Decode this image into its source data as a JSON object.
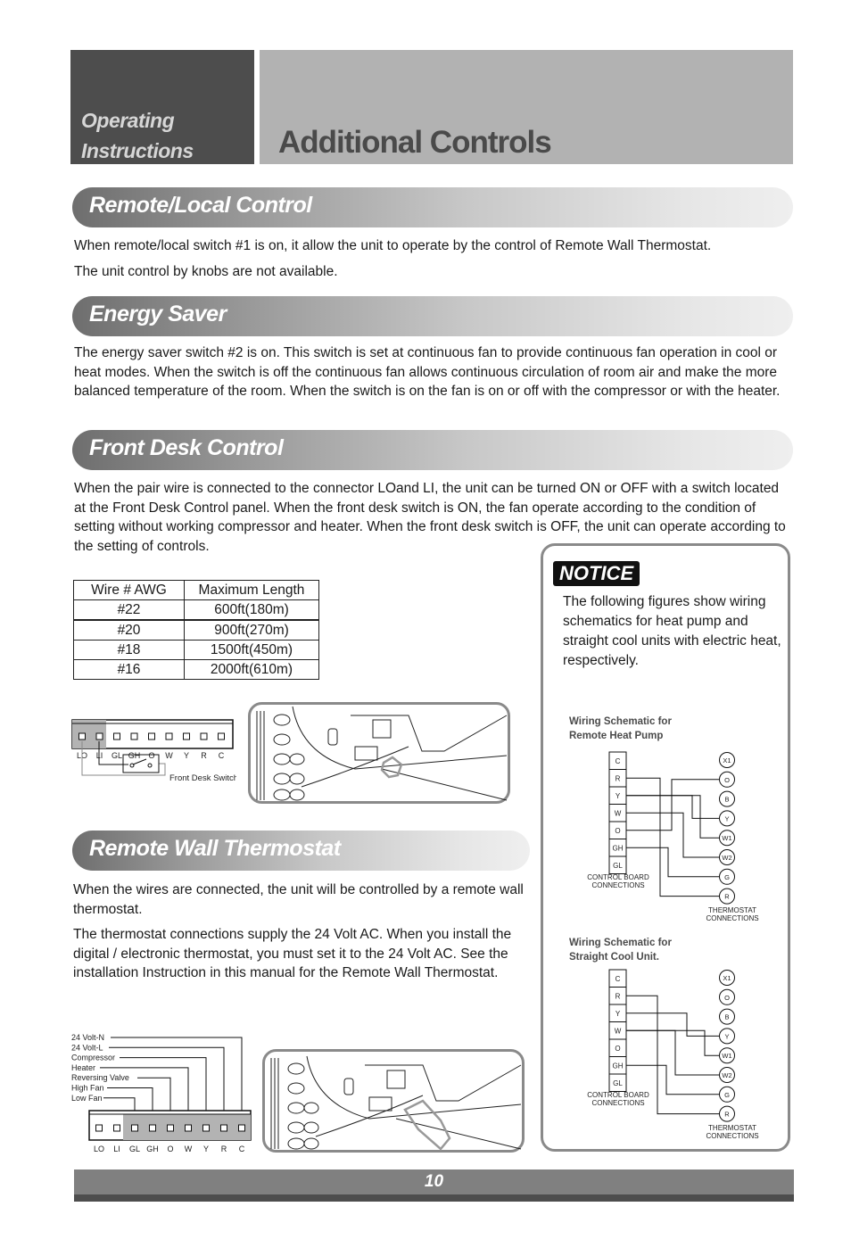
{
  "header": {
    "section_line1": "Operating",
    "section_line2": "Instructions",
    "title": "Additional Controls"
  },
  "sections": {
    "remote_local": {
      "title": "Remote/Local Control",
      "paragraphs": [
        "When remote/local switch #1 is on, it allow the unit to operate by the control of Remote Wall Thermostat.",
        "The unit control by knobs are not available."
      ]
    },
    "energy_saver": {
      "title": "Energy Saver",
      "paragraphs": [
        "The energy saver switch #2 is on. This switch is set at continuous fan to provide continuous fan operation in cool or heat modes. When the switch is off the continuous fan allows continuous circulation of room air and make the more balanced temperature of the room. When the switch is on the fan is on or off with the compressor or with the heater."
      ]
    },
    "front_desk": {
      "title": "Front Desk Control",
      "paragraphs": [
        "When the pair wire is connected to the connector LOand LI, the unit can be turned ON or OFF with a switch located at the Front Desk Control panel. When the front desk switch is ON, the fan operate according to the condition of setting without working compressor and heater. When the front desk switch is OFF, the unit can operate according to the setting of controls."
      ],
      "table": {
        "headers": [
          "Wire # AWG",
          "Maximum Length"
        ],
        "rows": [
          [
            "#22",
            "600ft(180m)"
          ],
          [
            "#20",
            "900ft(270m)"
          ],
          [
            "#18",
            "1500ft(450m)"
          ],
          [
            "#16",
            "2000ft(610m)"
          ]
        ]
      },
      "terminals": [
        "LO",
        "LI",
        "GL",
        "GH",
        "O",
        "W",
        "Y",
        "R",
        "C"
      ],
      "switch_label": "Front Desk Switch"
    },
    "remote_wall": {
      "title": "Remote Wall Thermostat",
      "paragraphs": [
        "When the wires are connected, the unit will be controlled by a remote wall thermostat.",
        "The thermostat connections supply the 24 Volt AC. When you install the digital / electronic thermostat, you must set it to the 24 Volt AC. See the installation Instruction in this manual for the Remote Wall Thermostat."
      ],
      "wire_labels": [
        "24 Volt-N",
        "24 Volt-L",
        "Compressor",
        "Heater",
        "Reversing Valve",
        "High Fan",
        "Low Fan"
      ],
      "terminals": [
        "LO",
        "LI",
        "GL",
        "GH",
        "O",
        "W",
        "Y",
        "R",
        "C"
      ]
    }
  },
  "notice": {
    "badge": "NOTICE",
    "text": "The following figures show wiring schematics for heat pump and straight cool units with electric heat, respectively.",
    "schematic1": {
      "title_line1": "Wiring Schematic for",
      "title_line2": "Remote Heat Pump",
      "board": [
        "C",
        "R",
        "Y",
        "W",
        "O",
        "GH",
        "GL"
      ],
      "thermostat": [
        "X1",
        "O",
        "B",
        "Y",
        "W1",
        "W2",
        "G",
        "R"
      ],
      "board_label1": "CONTROL BOARD",
      "board_label2": "CONNECTIONS",
      "thermo_label1": "THERMOSTAT",
      "thermo_label2": "CONNECTIONS"
    },
    "schematic2": {
      "title_line1": "Wiring Schematic for",
      "title_line2": "Straight Cool Unit.",
      "board": [
        "C",
        "R",
        "Y",
        "W",
        "O",
        "GH",
        "GL"
      ],
      "thermostat": [
        "X1",
        "O",
        "B",
        "Y",
        "W1",
        "W2",
        "G",
        "R"
      ],
      "board_label1": "CONTROL BOARD",
      "board_label2": "CONNECTIONS",
      "thermo_label1": "THERMOSTAT",
      "thermo_label2": "CONNECTIONS"
    }
  },
  "footer": {
    "page_number": "10"
  }
}
